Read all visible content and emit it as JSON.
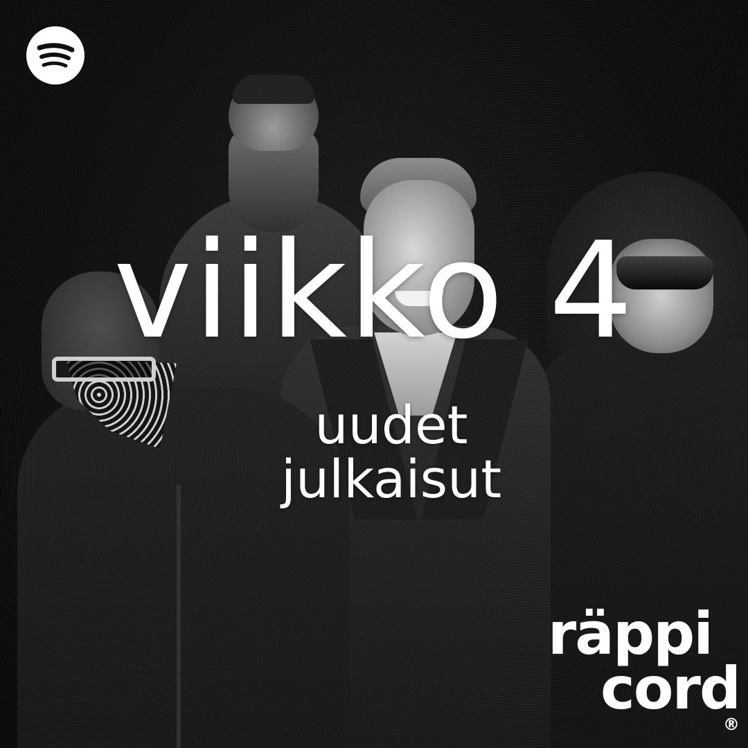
{
  "cover": {
    "title": "viikko 4",
    "subtitle_line1": "uudet",
    "subtitle_line2": "julkaisut",
    "brand_line1": "räppi",
    "brand_line2": "cord",
    "registered_mark": "®"
  },
  "icons": {
    "logo": "spotify-icon"
  },
  "colors": {
    "background": "#0b0b0b",
    "text": "#ffffff",
    "logo": "#ffffff"
  }
}
